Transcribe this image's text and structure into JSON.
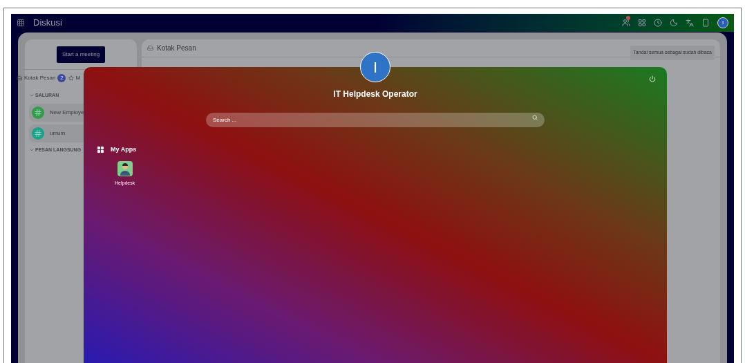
{
  "top_bar": {
    "title": "Diskusi",
    "user_initial": "I"
  },
  "sidebar": {
    "start_button": "Start a meeting",
    "tabs": [
      {
        "label": "Kotak Pesan",
        "count": "2"
      },
      {
        "label": "M"
      }
    ],
    "sections": [
      {
        "title": "SALURAN",
        "channels": [
          {
            "name": "New Employe",
            "color": "#2f9e44"
          },
          {
            "name": "umum",
            "color": "#1aa38c"
          }
        ]
      },
      {
        "title": "PESAN LANGSUNG"
      }
    ]
  },
  "main": {
    "title": "Kotak Pesan",
    "mark_all_button": "Tandai semua sebagai sudah dibaca"
  },
  "launcher": {
    "user_initial": "I",
    "user_name": "IT Helpdesk Operator",
    "search": {
      "placeholder": "Search ..."
    },
    "section_title": "My Apps",
    "apps": [
      {
        "label": "Helpdesk"
      }
    ]
  }
}
